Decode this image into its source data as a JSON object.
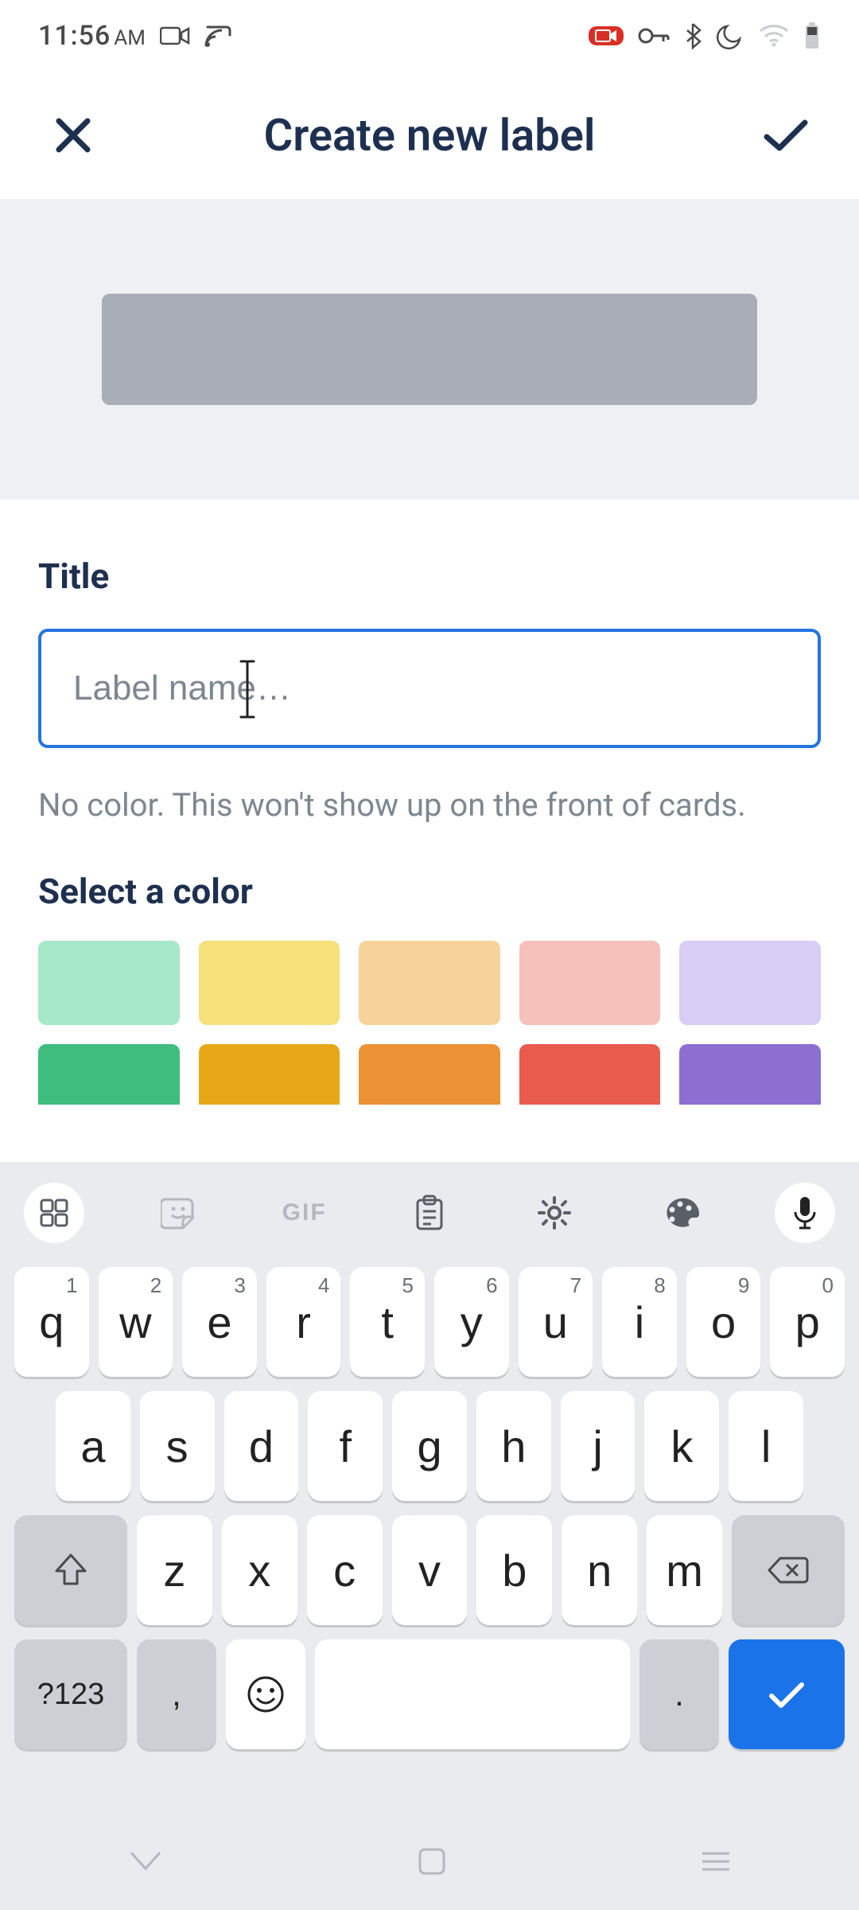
{
  "status": {
    "time": "11:56",
    "ampm": "AM"
  },
  "header": {
    "title": "Create new label"
  },
  "form": {
    "title_label": "Title",
    "title_placeholder": "Label name…",
    "title_value": "",
    "hint": "No color. This won't show up on the front of cards.",
    "select_color_label": "Select a color",
    "colors_row1": [
      "#a7e8c8",
      "#f5e07a",
      "#f8d29b",
      "#f7c1bb",
      "#d7cdf5"
    ],
    "colors_row2": [
      "#3fbd7e",
      "#e6a817",
      "#ec9134",
      "#e95b4d",
      "#8d6fd1"
    ]
  },
  "keyboard": {
    "row1": [
      {
        "k": "q",
        "n": "1"
      },
      {
        "k": "w",
        "n": "2"
      },
      {
        "k": "e",
        "n": "3"
      },
      {
        "k": "r",
        "n": "4"
      },
      {
        "k": "t",
        "n": "5"
      },
      {
        "k": "y",
        "n": "6"
      },
      {
        "k": "u",
        "n": "7"
      },
      {
        "k": "i",
        "n": "8"
      },
      {
        "k": "o",
        "n": "9"
      },
      {
        "k": "p",
        "n": "0"
      }
    ],
    "row2": [
      "a",
      "s",
      "d",
      "f",
      "g",
      "h",
      "j",
      "k",
      "l"
    ],
    "row3": [
      "z",
      "x",
      "c",
      "v",
      "b",
      "n",
      "m"
    ],
    "sym": "?123",
    "comma": ",",
    "period": ".",
    "gif": "GIF"
  }
}
